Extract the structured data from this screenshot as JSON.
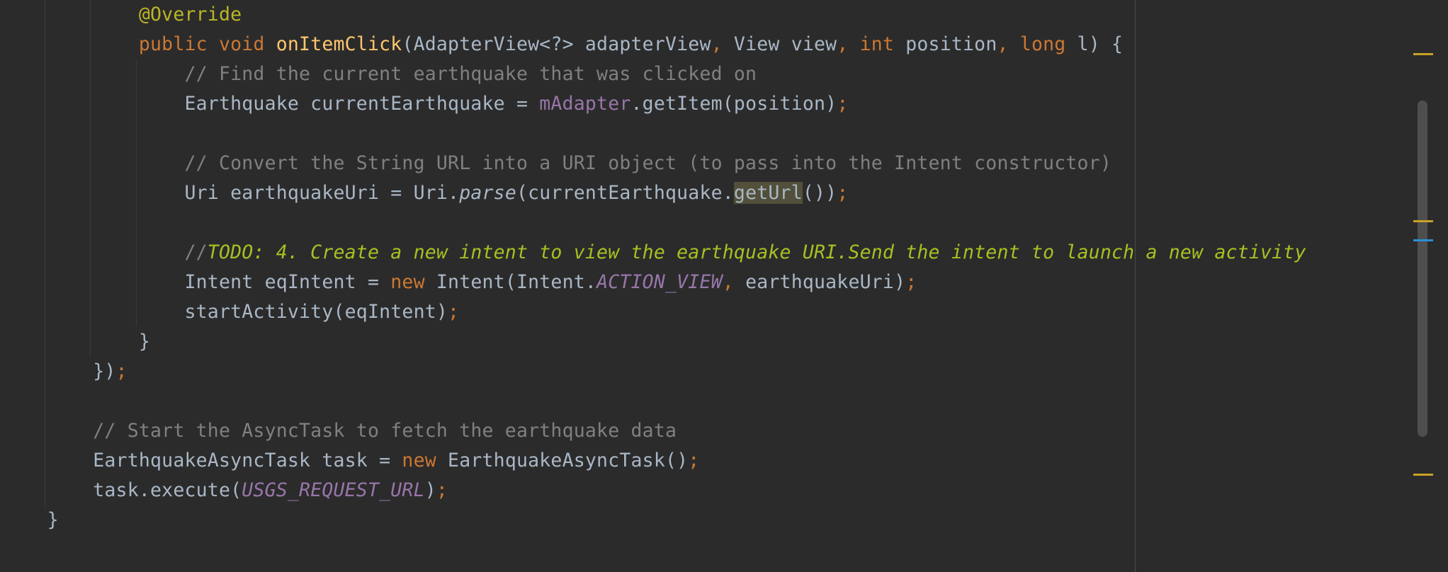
{
  "editor": {
    "lines": [
      {
        "id": "l1",
        "indent": "            ",
        "tokens": [
          {
            "t": "@Override",
            "c": "ann"
          }
        ]
      },
      {
        "id": "l2",
        "indent": "            ",
        "tokens": [
          {
            "t": "public",
            "c": "kw"
          },
          {
            "t": " "
          },
          {
            "t": "void",
            "c": "kw"
          },
          {
            "t": " "
          },
          {
            "t": "onItemClick",
            "c": "method"
          },
          {
            "t": "(AdapterView<?> adapterView"
          },
          {
            "t": ",",
            "c": "punct"
          },
          {
            "t": " View view"
          },
          {
            "t": ",",
            "c": "punct"
          },
          {
            "t": " "
          },
          {
            "t": "int",
            "c": "kw"
          },
          {
            "t": " position"
          },
          {
            "t": ",",
            "c": "punct"
          },
          {
            "t": " "
          },
          {
            "t": "long",
            "c": "kw"
          },
          {
            "t": " l) {"
          }
        ]
      },
      {
        "id": "l3",
        "indent": "                ",
        "tokens": [
          {
            "t": "// Find the current earthquake that was clicked on",
            "c": "comment"
          }
        ]
      },
      {
        "id": "l4",
        "indent": "                ",
        "tokens": [
          {
            "t": "Earthquake currentEarthquake = "
          },
          {
            "t": "mAdapter",
            "c": "field"
          },
          {
            "t": ".getItem(position)"
          },
          {
            "t": ";",
            "c": "punct"
          }
        ]
      },
      {
        "id": "l5",
        "indent": "",
        "tokens": []
      },
      {
        "id": "l6",
        "indent": "                ",
        "tokens": [
          {
            "t": "// Convert the String URL into a URI object (to pass into the Intent constructor)",
            "c": "comment"
          }
        ]
      },
      {
        "id": "l7",
        "indent": "                ",
        "tokens": [
          {
            "t": "Uri earthquakeUri = Uri."
          },
          {
            "t": "parse",
            "c": "static-call"
          },
          {
            "t": "(currentEarthquake."
          },
          {
            "t": "getUrl",
            "c": "hl"
          },
          {
            "t": "())"
          },
          {
            "t": ";",
            "c": "punct"
          }
        ]
      },
      {
        "id": "l8",
        "indent": "",
        "tokens": []
      },
      {
        "id": "l9",
        "indent": "                ",
        "tokens": [
          {
            "t": "//",
            "c": "comment"
          },
          {
            "t": "TODO: 4. Create a new intent to view the earthquake URI.Send the intent to launch a new activity",
            "c": "todo"
          }
        ]
      },
      {
        "id": "l10",
        "indent": "                ",
        "tokens": [
          {
            "t": "Intent eqIntent = "
          },
          {
            "t": "new",
            "c": "kw"
          },
          {
            "t": " Intent(Intent."
          },
          {
            "t": "ACTION_VIEW",
            "c": "static-field"
          },
          {
            "t": ",",
            "c": "punct"
          },
          {
            "t": " earthquakeUri)"
          },
          {
            "t": ";",
            "c": "punct"
          }
        ]
      },
      {
        "id": "l11",
        "indent": "                ",
        "tokens": [
          {
            "t": "startActivity(eqIntent)"
          },
          {
            "t": ";",
            "c": "punct"
          }
        ]
      },
      {
        "id": "l12",
        "indent": "            ",
        "tokens": [
          {
            "t": "}"
          }
        ]
      },
      {
        "id": "l13",
        "indent": "        ",
        "tokens": [
          {
            "t": "})"
          },
          {
            "t": ";",
            "c": "punct"
          }
        ]
      },
      {
        "id": "l14",
        "indent": "",
        "tokens": []
      },
      {
        "id": "l15",
        "indent": "        ",
        "tokens": [
          {
            "t": "// Start the AsyncTask to fetch the earthquake data",
            "c": "comment"
          }
        ]
      },
      {
        "id": "l16",
        "indent": "        ",
        "tokens": [
          {
            "t": "EarthquakeAsyncTask task = "
          },
          {
            "t": "new",
            "c": "kw"
          },
          {
            "t": " EarthquakeAsyncTask()"
          },
          {
            "t": ";",
            "c": "punct"
          }
        ]
      },
      {
        "id": "l17",
        "indent": "        ",
        "tokens": [
          {
            "t": "task.execute("
          },
          {
            "t": "USGS_REQUEST_URL",
            "c": "static-field"
          },
          {
            "t": ")"
          },
          {
            "t": ";",
            "c": "punct"
          }
        ]
      },
      {
        "id": "l18",
        "indent": "    ",
        "tokens": [
          {
            "t": "}"
          }
        ]
      }
    ]
  },
  "gutter_markers": [
    {
      "color": "yellow"
    },
    {
      "color": "yellow"
    },
    {
      "color": "blue"
    },
    {
      "color": "yellow"
    }
  ],
  "colors": {
    "background": "#2b2b2b",
    "keyword": "#cc7832",
    "annotation": "#bbb529",
    "method": "#ffc66d",
    "field": "#9876aa",
    "comment": "#808080",
    "todo": "#a8c023",
    "text": "#a9b7c6"
  }
}
